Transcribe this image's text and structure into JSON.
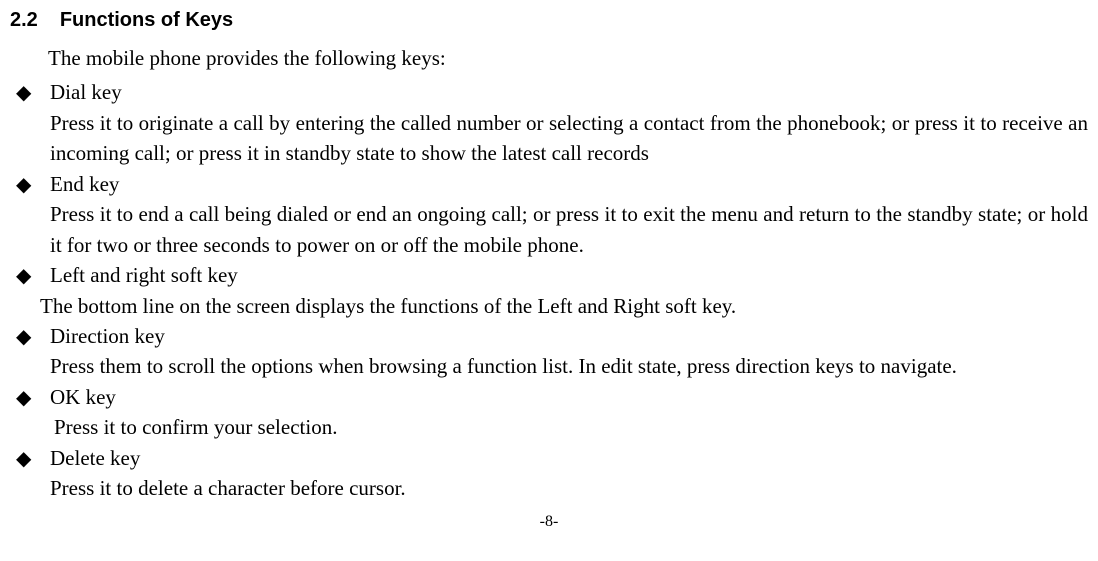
{
  "heading": {
    "number": "2.2",
    "title": "Functions of Keys"
  },
  "intro": "The mobile phone provides the following keys:",
  "items": [
    {
      "title": "Dial key",
      "desc": "Press it to originate a call by entering the called number or selecting a contact from the phonebook; or press it to receive an incoming call; or press it in standby state to show the latest call records",
      "descClass": "desc"
    },
    {
      "title": "End key",
      "desc": "Press it to end a call being dialed or end an ongoing call; or press it to exit the menu and return to the standby state; or hold it for two or three seconds to power on or off the mobile phone.",
      "descClass": "desc"
    },
    {
      "title": "Left and right soft key",
      "desc": "The bottom line on the screen displays the functions of the Left and Right soft key.",
      "descClass": "desc-indent-less"
    },
    {
      "title": "Direction key",
      "desc": "Press them to scroll the options when browsing a function list. In edit state, press direction keys to navigate.",
      "descClass": "desc"
    },
    {
      "title": "OK key",
      "desc": "Press it to confirm your selection.",
      "descClass": "desc-indent-more"
    },
    {
      "title": "Delete key",
      "desc": "Press it to delete a character before cursor.",
      "descClass": "desc"
    }
  ],
  "pageNumber": "-8-"
}
